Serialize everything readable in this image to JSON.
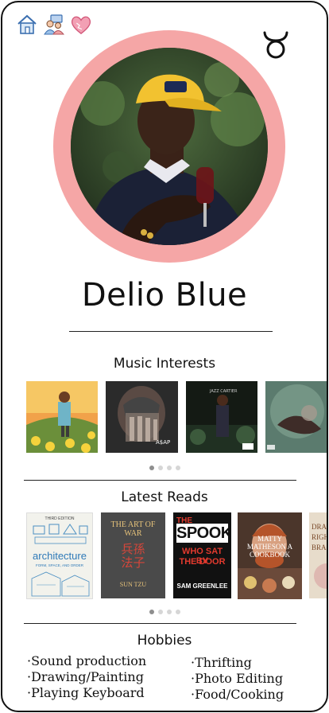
{
  "profile": {
    "name": "Delio Blue"
  },
  "nav": {
    "icons": [
      "home-icon",
      "people-icon",
      "heart-icon"
    ],
    "zodiac": "taurus-icon"
  },
  "colors": {
    "avatar_ring": "#f5a6a6",
    "dot_active": "#8e8e8e",
    "dot_inactive": "#d6d6d6"
  },
  "music": {
    "title": "Music Interests",
    "albums": [
      "album-1",
      "album-2",
      "album-3",
      "album-4"
    ],
    "carousel_page": 1,
    "carousel_pages": 4
  },
  "reads": {
    "title": "Latest Reads",
    "books": [
      {
        "title": "architecture",
        "subtitle": "FORM, SPACE, AND ORDER",
        "edition": "THIRD EDITION"
      },
      {
        "title": "THE ART OF WAR",
        "chinese": "兵孫 法子",
        "author": "SUN TZU"
      },
      {
        "title_lines": [
          "THE",
          "SPOOK",
          "WHO SAT BY",
          "THE DOOR"
        ],
        "author": "SAM GREENLEE"
      },
      {
        "title": "MATTY MATHESON A COOKBOOK"
      },
      {
        "title": "DRA RIGH BRA"
      }
    ],
    "carousel_page": 1,
    "carousel_pages": 4
  },
  "hobbies": {
    "title": "Hobbies",
    "left": [
      "·Sound production",
      "·Drawing/Painting",
      "·Playing Keyboard"
    ],
    "right": [
      "·Thrifting",
      "·Photo Editing",
      "·Food/Cooking"
    ]
  }
}
